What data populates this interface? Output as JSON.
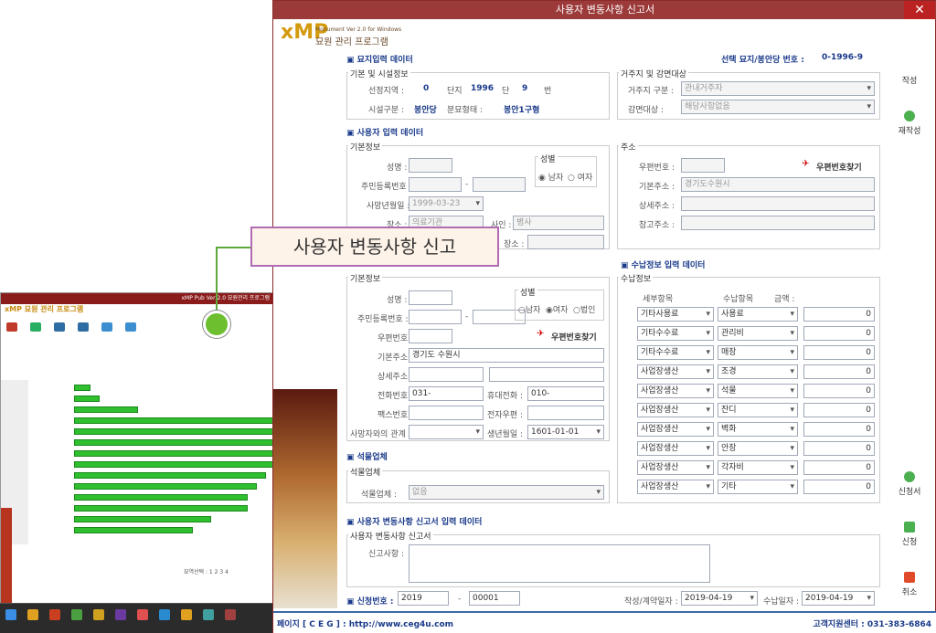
{
  "window": {
    "title": "사용자 변동사항 신고서",
    "close": "✕"
  },
  "logo": {
    "brand": "xMP",
    "subtitle": "Monument Ver 2.0 for Windows",
    "korean": "묘원 관리 프로그램"
  },
  "callout": {
    "text": "사용자 변동사항 신고"
  },
  "sections": {
    "grave": "묘지입력 데이터",
    "user": "사용자 입력 데이터",
    "stone": "석물업체",
    "change": "사용자 변동사항 신고서 입력 데이터",
    "payment": "수납정보 입력 데이터"
  },
  "grave": {
    "selected_label": "선택 묘지/봉안당 번호 :",
    "selected_value": "0-1996-9",
    "facility_group": "기본 및 시설정보",
    "region_label": "선정지역 :",
    "region_value": "0",
    "block_label": "단지",
    "block_value": "1996",
    "row_label": "단",
    "row_value": "9",
    "num_label": "번",
    "type_label": "시설구분 :",
    "type_value": "봉안당",
    "form_label": "분묘형태 :",
    "form_value": "봉안1구형",
    "resident_group": "거주지 및 감면대상",
    "resident_label": "거주지 구분 :",
    "resident_value": "관내거주자",
    "discount_label": "감면대상 :",
    "discount_value": "해당사항없음"
  },
  "deceased": {
    "group": "기본정보",
    "name_label": "성명 :",
    "name_value": "",
    "rrn_label": "주민등록번호 :",
    "death_label": "사망년월일 :",
    "death_value": "1999-03-23",
    "burial_label": "장소 :",
    "burial_value": "의료기관",
    "cause_label": "사인 :",
    "cause_value": "병사",
    "place_label": "장소 :",
    "gender_group": "성별",
    "male": "남자",
    "female": "여자",
    "addr_group": "주소",
    "zip_label": "우편번호 :",
    "zip_search": "우편번호찾기",
    "addr_label": "기본주소 :",
    "addr_value": "경기도수원시",
    "addr2_label": "상세주소 :",
    "ref_label": "참고주소 :"
  },
  "applicant": {
    "group": "기본정보",
    "name_label": "성명 :",
    "rrn_label": "주민등록번호 :",
    "gender_group": "성별",
    "male": "남자",
    "female": "여자",
    "corp": "법인",
    "zip_label": "우편번호 :",
    "zip_search": "우편번호찾기",
    "addr_label": "기본주소 :",
    "addr_value": "경기도 수원시",
    "addr2_label": "상세주소 :",
    "tel_label": "전화번호 :",
    "tel_value": "031-",
    "mobile_label": "휴대전화 :",
    "mobile_value": "010-",
    "fax_label": "팩스번호 :",
    "email_label": "전자우편 :",
    "relation_label": "사망자와의 관계 :",
    "birth_label": "생년월일 :",
    "birth_value": "1601-01-01"
  },
  "stone": {
    "group": "석물업체",
    "label": "석물업체 :",
    "value": "없음"
  },
  "change": {
    "group": "사용자 변동사항 신고서",
    "report_label": "신고사항 :"
  },
  "payment": {
    "group": "수납정보",
    "col_detail": "세부항목",
    "col_item": "수납항목",
    "col_amount": "금액 :",
    "rows": [
      {
        "detail": "기타사용료",
        "item": "사용료",
        "amount": "0"
      },
      {
        "detail": "기타수수료",
        "item": "관리비",
        "amount": "0"
      },
      {
        "detail": "기타수수료",
        "item": "매장",
        "amount": "0"
      },
      {
        "detail": "사업장생산",
        "item": "조경",
        "amount": "0"
      },
      {
        "detail": "사업장생산",
        "item": "석물",
        "amount": "0"
      },
      {
        "detail": "사업장생산",
        "item": "잔디",
        "amount": "0"
      },
      {
        "detail": "사업장생산",
        "item": "벽화",
        "amount": "0"
      },
      {
        "detail": "사업장생산",
        "item": "안장",
        "amount": "0"
      },
      {
        "detail": "사업장생산",
        "item": "각자비",
        "amount": "0"
      },
      {
        "detail": "사업장생산",
        "item": "기타",
        "amount": "0"
      }
    ]
  },
  "footer": {
    "apply_label": "신청번호 :",
    "apply_year": "2019",
    "apply_num": "00001",
    "contract_label": "작성/계약일자 :",
    "contract_date": "2019-04-19",
    "receipt_label": "수납일자 :",
    "receipt_date": "2019-04-19"
  },
  "side": {
    "write": "작성",
    "rewrite": "재작성",
    "form": "신청서",
    "apply": "신청",
    "cancel": "취소"
  },
  "status": {
    "homepage": "페이지 [ C E G ] : http://www.ceg4u.com",
    "support": "고객지원센터 : 031-383-6864"
  },
  "mini": {
    "title": "xMP Pub Ver 2.0 묘원관리 프로그램",
    "logo": "xMP 묘원 관리 프로그램",
    "pager": "묘역선택 :  1  2  3  4"
  },
  "colors": {
    "title_bar": "#9c3a3a",
    "accent": "#1a3a8a",
    "grid_green": "#2fbf2f",
    "callout_border": "#b16bb3",
    "dot": "#6dbf2f"
  }
}
